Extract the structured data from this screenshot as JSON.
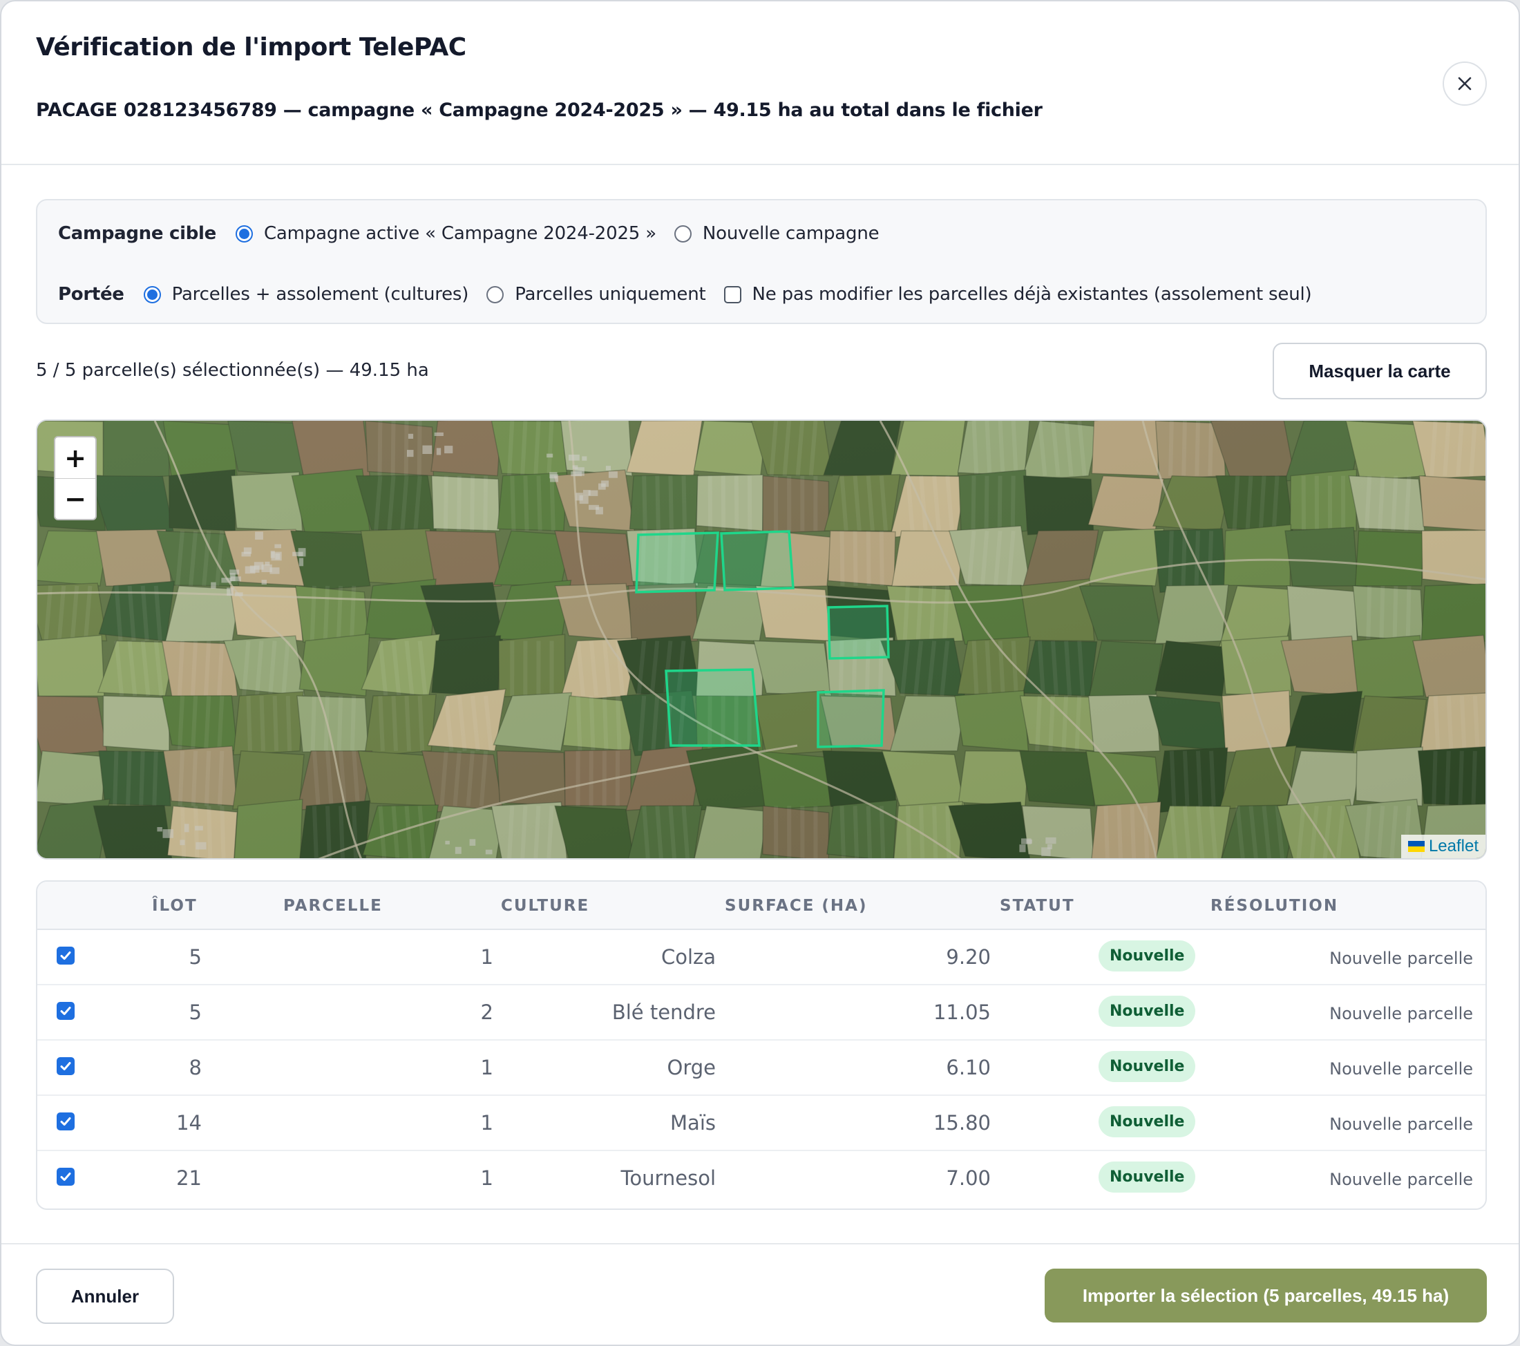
{
  "dialog": {
    "title": "Vérification de l'import TelePAC",
    "subtitle": "PACAGE 028123456789 — campagne « Campagne 2024-2025 » — 49.15 ha au total dans le fichier",
    "close_icon": "close-icon"
  },
  "options": {
    "campaign_label": "Campagne cible",
    "campaign_active": "Campagne active « Campagne 2024-2025 »",
    "campaign_new": "Nouvelle campagne",
    "campaign_selected": "active",
    "scope_label": "Portée",
    "scope_full": "Parcelles + assolement (cultures)",
    "scope_parcels": "Parcelles uniquement",
    "scope_selected": "full",
    "keep_existing": "Ne pas modifier les parcelles déjà existantes (assolement seul)",
    "keep_existing_checked": false
  },
  "selection_summary": "5 / 5 parcelle(s) sélectionnée(s) — 49.15 ha",
  "toggle_map_label": "Masquer la carte",
  "map": {
    "zoom_in": "+",
    "zoom_out": "−",
    "attribution": "Leaflet",
    "parcel_color": "#2ee59a"
  },
  "table": {
    "headers": [
      "ÎLOT",
      "PARCELLE",
      "CULTURE",
      "SURFACE (HA)",
      "STATUT",
      "RÉSOLUTION"
    ],
    "rows": [
      {
        "checked": true,
        "ilot": "5",
        "parcelle": "1",
        "culture": "Colza",
        "surface": "9.20",
        "statut": "Nouvelle",
        "resolution": "Nouvelle parcelle"
      },
      {
        "checked": true,
        "ilot": "5",
        "parcelle": "2",
        "culture": "Blé tendre",
        "surface": "11.05",
        "statut": "Nouvelle",
        "resolution": "Nouvelle parcelle"
      },
      {
        "checked": true,
        "ilot": "8",
        "parcelle": "1",
        "culture": "Orge",
        "surface": "6.10",
        "statut": "Nouvelle",
        "resolution": "Nouvelle parcelle"
      },
      {
        "checked": true,
        "ilot": "14",
        "parcelle": "1",
        "culture": "Maïs",
        "surface": "15.80",
        "statut": "Nouvelle",
        "resolution": "Nouvelle parcelle"
      },
      {
        "checked": true,
        "ilot": "21",
        "parcelle": "1",
        "culture": "Tournesol",
        "surface": "7.00",
        "statut": "Nouvelle",
        "resolution": "Nouvelle parcelle"
      }
    ]
  },
  "footer": {
    "cancel_label": "Annuler",
    "import_label": "Importer la sélection (5 parcelles, 49.15 ha)"
  },
  "colors": {
    "accent": "#1e6fe0",
    "primary_button": "#88995b",
    "badge_bg": "#d8f5e3",
    "badge_text": "#0f5e35"
  }
}
